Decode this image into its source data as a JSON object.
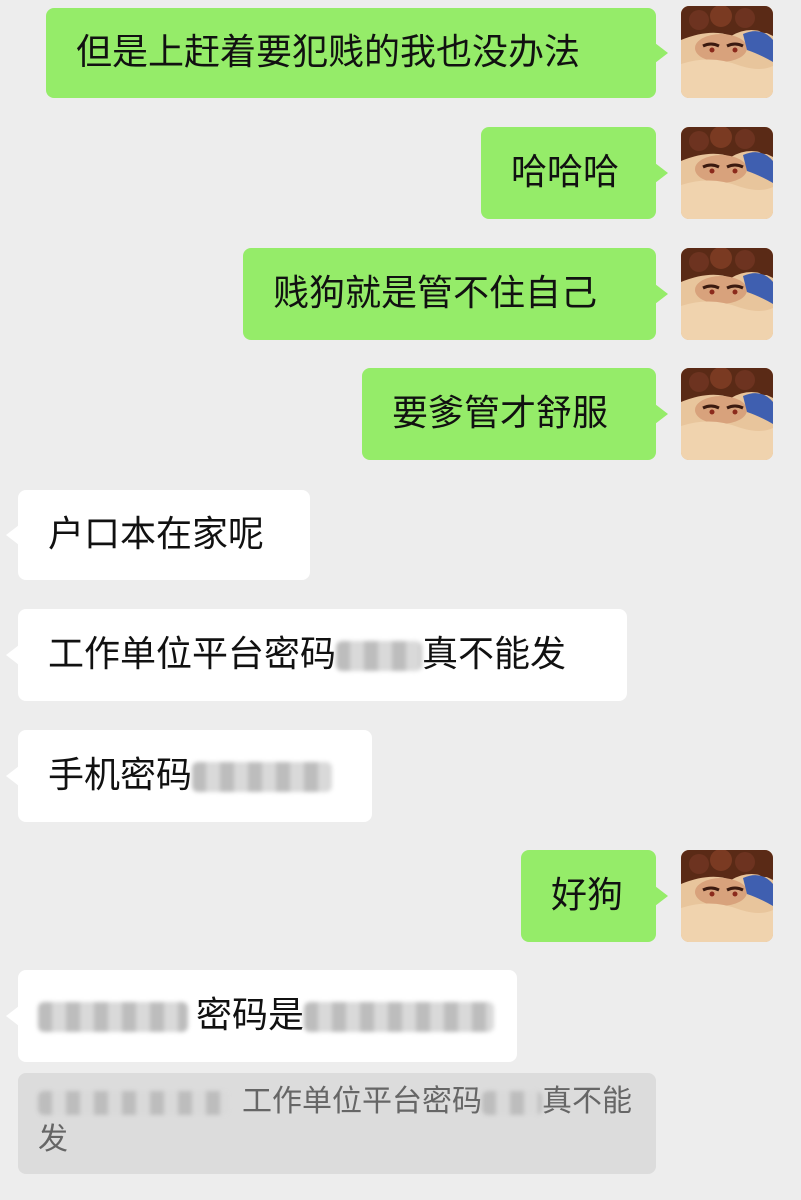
{
  "messages": [
    {
      "side": "out",
      "text": "但是上赶着要犯贱的我也没办法"
    },
    {
      "side": "out",
      "text": "哈哈哈"
    },
    {
      "side": "out",
      "text": "贱狗就是管不住自己"
    },
    {
      "side": "out",
      "text": "要爹管才舒服"
    },
    {
      "side": "in",
      "text": "户口本在家呢"
    },
    {
      "side": "in",
      "text_before": "工作单位平台密码",
      "text_after": "真不能发"
    },
    {
      "side": "in",
      "text_before": "手机密码"
    },
    {
      "side": "out",
      "text": "好狗"
    },
    {
      "side": "in",
      "text_middle": "密码是"
    }
  ],
  "quote": {
    "text_after": "工作单位平台密码",
    "text_end": "真不能发"
  },
  "icons": {
    "avatar": "avatar-image"
  },
  "colors": {
    "outgoing": "#95ec69",
    "incoming": "#ffffff",
    "background": "#ededed"
  }
}
